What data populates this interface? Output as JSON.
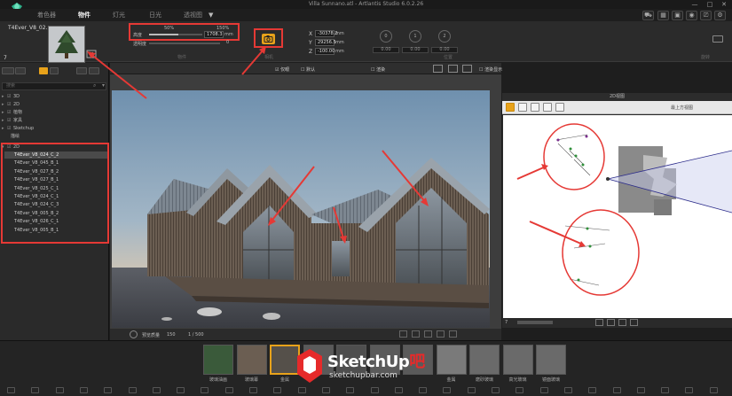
{
  "window": {
    "title": "Villa Sunnano.atl - Artlantis Studio 6.0.2.26",
    "controls": [
      "—",
      "□",
      "✕"
    ]
  },
  "tabs": [
    {
      "label": "着色器",
      "active": false
    },
    {
      "label": "物件",
      "active": true
    },
    {
      "label": "灯光",
      "active": false
    },
    {
      "label": "日光",
      "active": false
    },
    {
      "label": "透视图",
      "active": false
    }
  ],
  "tab_dropdown": "▼",
  "object": {
    "name": "T4Ever_V8_02...",
    "index": "7",
    "group_label": "物件",
    "camera_label": "相机",
    "position_label": "位置",
    "rotation_label": "旋转"
  },
  "sliders": {
    "min_label": "50%",
    "max_label": "150%",
    "height_label": "高度",
    "height_value": "1708.3",
    "height_unit": "mm",
    "opacity_label": "透明度",
    "opacity_value": "0",
    "height_fill": 0.55,
    "opacity_fill": 0.0
  },
  "position": {
    "x_label": "X",
    "x_value": "-30378.2",
    "x_unit": "mm",
    "y_label": "Y",
    "y_value": "29256.5",
    "y_unit": "mm",
    "z_label": "Z",
    "z_value": "-100.00",
    "z_unit": "mm"
  },
  "rotation": {
    "circles": [
      "0",
      "1",
      "2"
    ],
    "values": [
      "0.00",
      "0.00",
      "0.00"
    ]
  },
  "left_panel": {
    "search_placeholder": "搜索",
    "groups": [
      {
        "label": "3D",
        "expanded": false
      },
      {
        "label": "2D",
        "expanded": false
      },
      {
        "label": "植物",
        "expanded": false
      },
      {
        "label": "家具",
        "expanded": false
      },
      {
        "label": "Sketchup",
        "expanded": false
      },
      {
        "label": "描绘",
        "expanded": false
      }
    ],
    "group_2d": "2D",
    "objects": [
      "T4Ever_V8_024_C_2",
      "T4Ever_V8_045_B_1",
      "T4Ever_V8_027_B_2",
      "T4Ever_V8_027_B_1",
      "T4Ever_V8_025_C_1",
      "T4Ever_V8_024_C_1",
      "T4Ever_V8_024_C_3",
      "T4Ever_V8_005_B_2",
      "T4Ever_V8_026_C_1",
      "T4Ever_V8_005_B_1"
    ],
    "selected_index": 0
  },
  "viewport": {
    "toolbar_checkbox": "仅眼",
    "toolbar_layer": "默认",
    "toolbar_mode": "渲染",
    "toolbar_right": "渲染显示",
    "status_quality": "预览质量",
    "status_value": "150",
    "status_page": "1 / 500"
  },
  "panel2d": {
    "title": "2D视图",
    "dropdown": "最上方视图",
    "index": "7"
  },
  "bottom_thumbs": [
    {
      "label": "玻璃油画",
      "active": false
    },
    {
      "label": "玻璃幕",
      "active": false
    },
    {
      "label": "金属",
      "active": true
    },
    {
      "label": "",
      "active": false
    },
    {
      "label": "",
      "active": false
    },
    {
      "label": "",
      "active": false
    },
    {
      "label": "",
      "active": false
    },
    {
      "label": "金属",
      "active": false
    },
    {
      "label": "磨砂玻璃",
      "active": false
    },
    {
      "label": "高光玻璃",
      "active": false
    },
    {
      "label": "镜面玻璃",
      "active": false
    }
  ],
  "watermark": {
    "brand": "SketchUp",
    "brand_suffix": "吧",
    "url": "sketchupbar.com"
  },
  "colors": {
    "accent": "#e8a21a",
    "annotation": "#e53935",
    "logo": "#2fb48c"
  }
}
